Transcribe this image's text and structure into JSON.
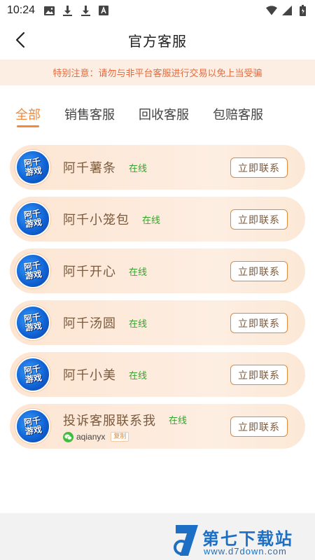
{
  "status_bar": {
    "time": "10:24",
    "left_icons": [
      "image-icon",
      "download-icon",
      "download-icon",
      "font-icon"
    ],
    "right_icons": [
      "wifi-icon",
      "signal-icon",
      "battery-icon"
    ]
  },
  "header": {
    "title": "官方客服",
    "back_icon": "chevron-left-icon"
  },
  "notice": {
    "text": "特别注意：请勿与非平台客服进行交易以免上当受骗"
  },
  "tabs": [
    {
      "label": "全部",
      "active": true
    },
    {
      "label": "销售客服",
      "active": false
    },
    {
      "label": "回收客服",
      "active": false
    },
    {
      "label": "包赔客服",
      "active": false
    }
  ],
  "agents": [
    {
      "name": "阿千薯条",
      "status": "在线",
      "button": "立即联系"
    },
    {
      "name": "阿千小笼包",
      "status": "在线",
      "button": "立即联系"
    },
    {
      "name": "阿千开心",
      "status": "在线",
      "button": "立即联系"
    },
    {
      "name": "阿千汤圆",
      "status": "在线",
      "button": "立即联系"
    },
    {
      "name": "阿千小美",
      "status": "在线",
      "button": "立即联系"
    },
    {
      "name": "投诉客服联系我",
      "status": "在线",
      "button": "立即联系",
      "wechat_id": "aqianyx",
      "copy_label": "复制"
    }
  ],
  "avatar_logo": {
    "line1": "阿千",
    "line2": "游戏"
  },
  "watermark": {
    "title": "第七下载站",
    "url": "www.d7down.com"
  },
  "colors": {
    "accent": "#f08a3c",
    "notice_text": "#e36b3f",
    "notice_bg": "#fdeee3",
    "online": "#3aa030",
    "card_bg": "#fde5d2",
    "name_text": "#7a5a3e",
    "watermark": "#1c6fc4"
  }
}
